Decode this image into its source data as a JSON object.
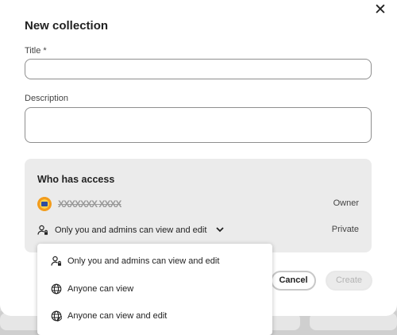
{
  "dialog": {
    "title": "New collection",
    "close_glyph": "✕"
  },
  "form": {
    "title_label": "Title *",
    "title_value": "",
    "description_label": "Description",
    "description_value": ""
  },
  "access": {
    "heading": "Who has access",
    "owner_name": "XXXXXXX XXXX",
    "owner_role": "Owner",
    "permission_label": "Only you and admins can view and edit",
    "permission_status": "Private"
  },
  "buttons": {
    "cancel": "Cancel",
    "create": "Create"
  },
  "dropdown": {
    "options": [
      {
        "label": "Only you and admins can view and edit",
        "icon": "person-lock-icon"
      },
      {
        "label": "Anyone can view",
        "icon": "globe-icon"
      },
      {
        "label": "Anyone can view and edit",
        "icon": "globe-edit-icon"
      }
    ]
  }
}
